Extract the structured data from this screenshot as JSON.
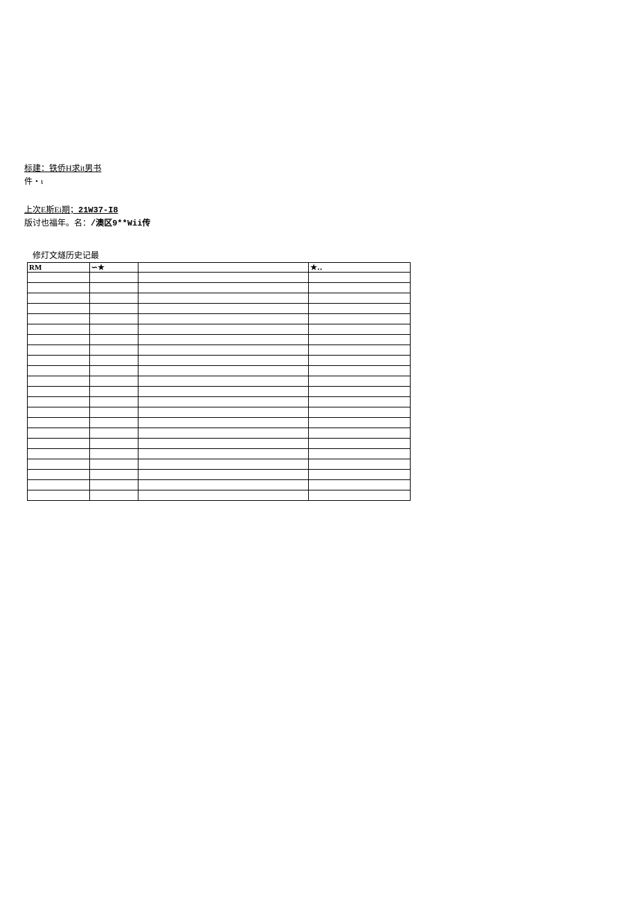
{
  "header": {
    "line1_label": "标建",
    "line1_colon": "：",
    "line1_value": "铁侨H求it男书",
    "line2": "件・ι",
    "line3_label": "上次E斯Ei期",
    "line3_sep": "；",
    "line3_value": "21W37-I8",
    "line4_label": "版讨也福年。名：",
    "line4_value": "/澳区9**Wii传"
  },
  "table": {
    "title": "修灯文燧历史记最",
    "headers": {
      "c1": "RM",
      "c2": "∽★",
      "c3": "",
      "c4": "★‥"
    },
    "rows": 22
  }
}
